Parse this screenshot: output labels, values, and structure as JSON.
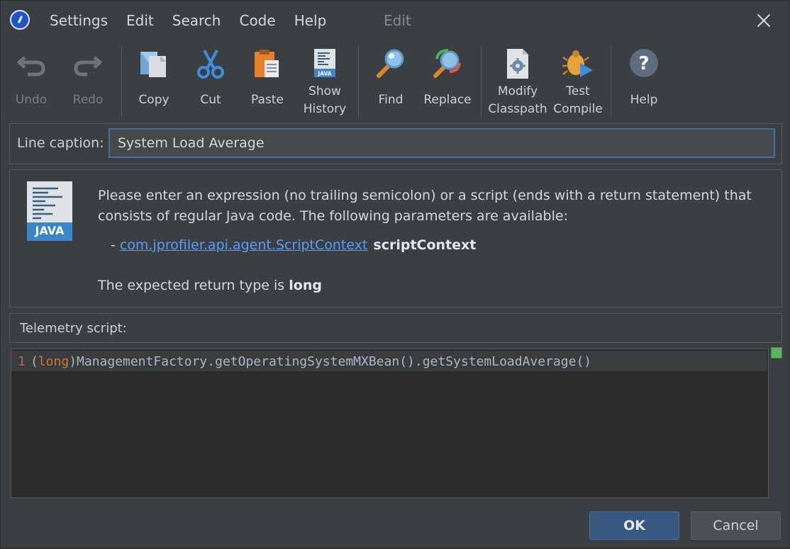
{
  "menu": {
    "items": [
      "Settings",
      "Edit",
      "Search",
      "Code",
      "Help"
    ],
    "window_title": "Edit"
  },
  "toolbar": {
    "undo": "Undo",
    "redo": "Redo",
    "copy": "Copy",
    "cut": "Cut",
    "paste": "Paste",
    "show_history": "Show\nHistory",
    "find": "Find",
    "replace": "Replace",
    "modify_classpath": "Modify\nClasspath",
    "test_compile": "Test\nCompile",
    "help": "Help"
  },
  "caption": {
    "label": "Line caption:",
    "value": "System Load Average"
  },
  "info": {
    "icon_text": "JAVA",
    "description": "Please enter an expression (no trailing semicolon) or a script (ends with a return statement) that consists of regular Java code. The following parameters are available:",
    "param_prefix": "- ",
    "param_type": "com.jprofiler.api.agent.ScriptContext",
    "param_name": "scriptContext",
    "return_prefix": "The expected return type is ",
    "return_type": "long"
  },
  "script": {
    "label": "Telemetry script:",
    "line_number": "1",
    "code_open": "(",
    "code_keyword": "long",
    "code_rest": ")ManagementFactory.getOperatingSystemMXBean().getSystemLoadAverage()"
  },
  "buttons": {
    "ok": "OK",
    "cancel": "Cancel"
  },
  "colors": {
    "background": "#3c3f41",
    "editor_bg": "#2b2b2b",
    "link": "#589df6",
    "keyword": "#cc7832",
    "ok_button": "#365880",
    "status_ok": "#5bb55f"
  }
}
